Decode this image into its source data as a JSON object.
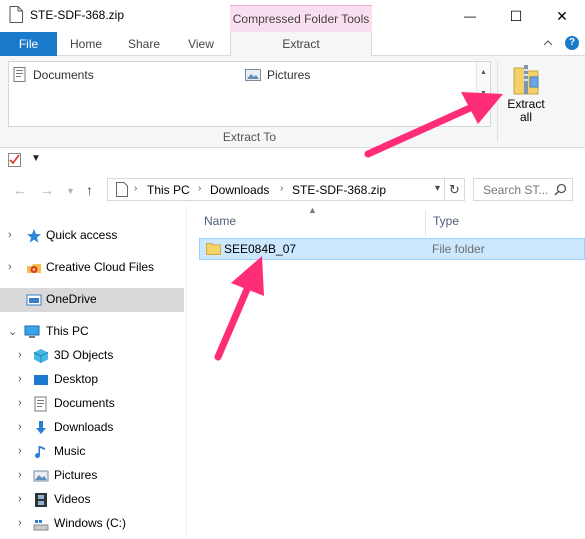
{
  "window": {
    "title": "STE-SDF-368.zip",
    "contextual_tab_group": "Compressed Folder Tools",
    "minimize_glyph": "—",
    "maximize_glyph": "☐",
    "close_glyph": "✕"
  },
  "ribbon_tabs": [
    {
      "label": "File"
    },
    {
      "label": "Home"
    },
    {
      "label": "Share"
    },
    {
      "label": "View"
    },
    {
      "label": "Extract",
      "active": true
    }
  ],
  "ribbon": {
    "gallery_items": [
      {
        "label": "Documents",
        "icon": "documents-icon"
      },
      {
        "label": "Pictures",
        "icon": "pictures-icon"
      }
    ],
    "group_label": "Extract To",
    "extract_all": {
      "line1": "Extract",
      "line2": "all"
    }
  },
  "address": {
    "crumbs": [
      "This PC",
      "Downloads",
      "STE-SDF-368.zip"
    ],
    "search_placeholder": "Search ST..."
  },
  "nav_pane": [
    {
      "label": "Quick access",
      "icon": "star-icon",
      "expand": true
    },
    {
      "label": "Creative Cloud Files",
      "icon": "creative-cloud-icon",
      "expand": true
    },
    {
      "label": "OneDrive",
      "icon": "onedrive-icon",
      "expand": false,
      "selected": true
    },
    {
      "label": "This PC",
      "icon": "computer-icon",
      "expand": true,
      "expanded": true
    },
    {
      "label": "3D Objects",
      "icon": "cube-icon",
      "expand": true
    },
    {
      "label": "Desktop",
      "icon": "desktop-icon",
      "expand": true
    },
    {
      "label": "Documents",
      "icon": "documents-icon",
      "expand": true
    },
    {
      "label": "Downloads",
      "icon": "download-arrow-icon",
      "expand": true
    },
    {
      "label": "Music",
      "icon": "music-note-icon",
      "expand": true
    },
    {
      "label": "Pictures",
      "icon": "pictures-icon",
      "expand": true
    },
    {
      "label": "Videos",
      "icon": "film-icon",
      "expand": true
    },
    {
      "label": "Windows (C:)",
      "icon": "drive-icon",
      "expand": true
    }
  ],
  "file_list": {
    "columns": [
      "Name",
      "Type"
    ],
    "rows": [
      {
        "name": "SEE084B_07",
        "type": "File folder",
        "selected": true
      }
    ]
  },
  "colors": {
    "file_tab": "#1979ca",
    "contextual_tab": "#fadff0",
    "selection": "#cce8ff",
    "annotation_arrow": "#ff2d78"
  }
}
